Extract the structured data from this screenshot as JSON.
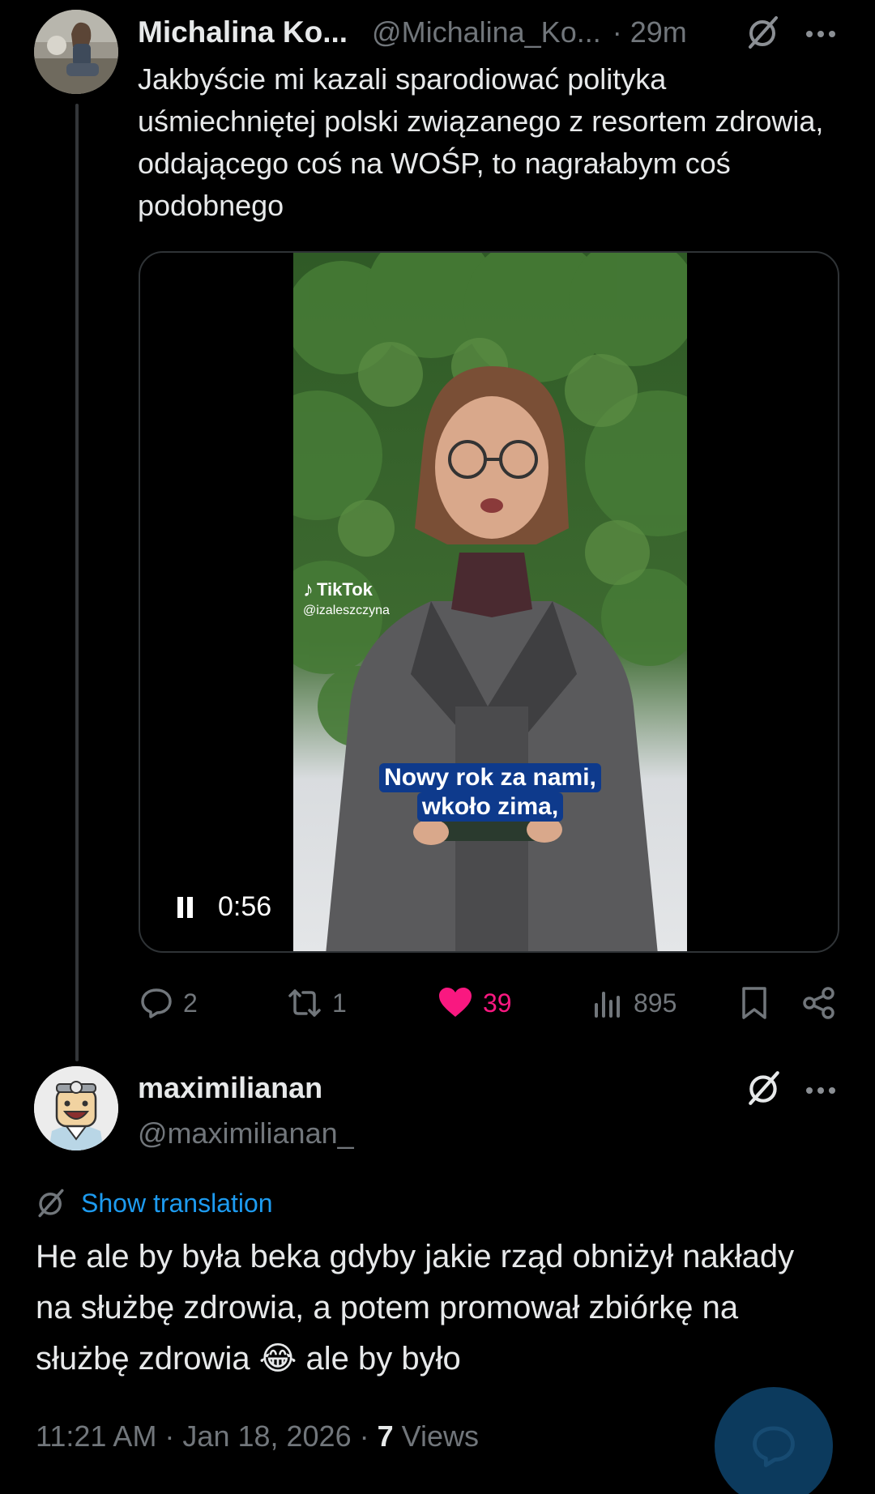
{
  "tweet": {
    "author_name": "Michalina Ko...",
    "author_handle": "@Michalina_Ko...",
    "time": "· 29m",
    "text": "Jakbyście mi kazali sparodiować polityka uśmiechniętej polski związanego z resortem zdrowia, oddającego coś na WOŚP, to nagrałabym coś podobnego",
    "video": {
      "duration": "0:56",
      "watermark": "TikTok",
      "watermark_handle": "@izaleszczyna",
      "caption_line1": "Nowy rok za nami,",
      "caption_line2": "wkoło zima,"
    },
    "actions": {
      "replies": "2",
      "reposts": "1",
      "likes": "39",
      "views": "895"
    },
    "colors": {
      "like": "#f91880",
      "muted": "#71767b",
      "link": "#1d9bf0"
    }
  },
  "reply": {
    "author_name": "maximilianan",
    "author_handle": "@maximilianan_",
    "translation_label": "Show translation",
    "text": "He ale by była beka gdyby jakie rząd obniżył nakłady na służbę zdrowia, a potem promował zbiórkę na służbę zdrowia 😂 ale by było",
    "timestamp": "11:21 AM · Jan 18, 2026 · ",
    "views_count": "7",
    "views_label": "Views"
  }
}
